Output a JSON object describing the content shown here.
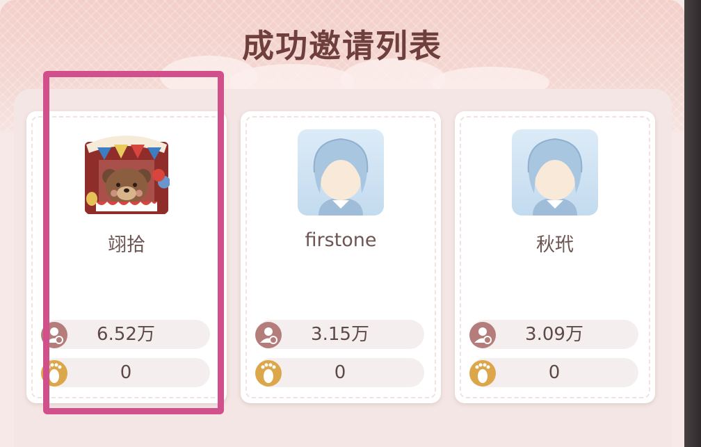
{
  "title": "成功邀请列表",
  "colors": {
    "title": "#6e3f3c",
    "highlight_border": "#d14f8a",
    "avatar_blue": "#a9c6e0",
    "friends_icon": "#b57c7c",
    "footprint_icon": "#dba74a"
  },
  "invitees": [
    {
      "name": "翊拾",
      "avatar": "bear-carnival-avatar",
      "followers": "6.52万",
      "footprints": "0",
      "highlighted": true
    },
    {
      "name": "firstone",
      "avatar": "default-boy-avatar",
      "followers": "3.15万",
      "footprints": "0",
      "highlighted": false
    },
    {
      "name": "秋玳",
      "avatar": "default-boy-avatar",
      "followers": "3.09万",
      "footprints": "0",
      "highlighted": false
    }
  ],
  "icons": {
    "followers": "person-icon",
    "footprints": "footprint-icon"
  }
}
